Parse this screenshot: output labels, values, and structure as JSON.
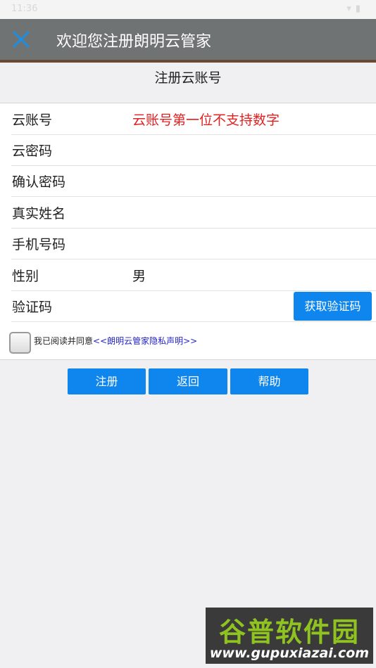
{
  "status_bar": {
    "time": "11:36",
    "icons": [
      "wifi-icon",
      "battery-icon"
    ]
  },
  "app_bar": {
    "title": "欢迎您注册朗明云管家",
    "close_icon": "close-icon",
    "close_color": "#1a8fe8"
  },
  "page": {
    "subtitle": "注册云账号"
  },
  "form": {
    "fields": [
      {
        "label": "云账号",
        "value": "云账号第一位不支持数字",
        "value_color": "#e32020"
      },
      {
        "label": "云密码",
        "value": ""
      },
      {
        "label": "确认密码",
        "value": ""
      },
      {
        "label": "真实姓名",
        "value": ""
      },
      {
        "label": "手机号码",
        "value": ""
      },
      {
        "label": "性别",
        "value": "男"
      },
      {
        "label": "验证码",
        "value": ""
      }
    ],
    "get_code_label": "获取验证码",
    "agreement": {
      "checked": false,
      "text": "我已阅读并同意",
      "link": "<<朗明云管家隐私声明>>"
    }
  },
  "actions": {
    "register_label": "注册",
    "back_label": "返回",
    "help_label": "帮助"
  },
  "watermark": {
    "top": "谷普软件园",
    "bottom": "www.gupuxiazai.com"
  },
  "colors": {
    "primary": "#0f86ee",
    "app_bar": "#707374",
    "accent_line": "#6a4a33",
    "link": "#2323c8"
  }
}
